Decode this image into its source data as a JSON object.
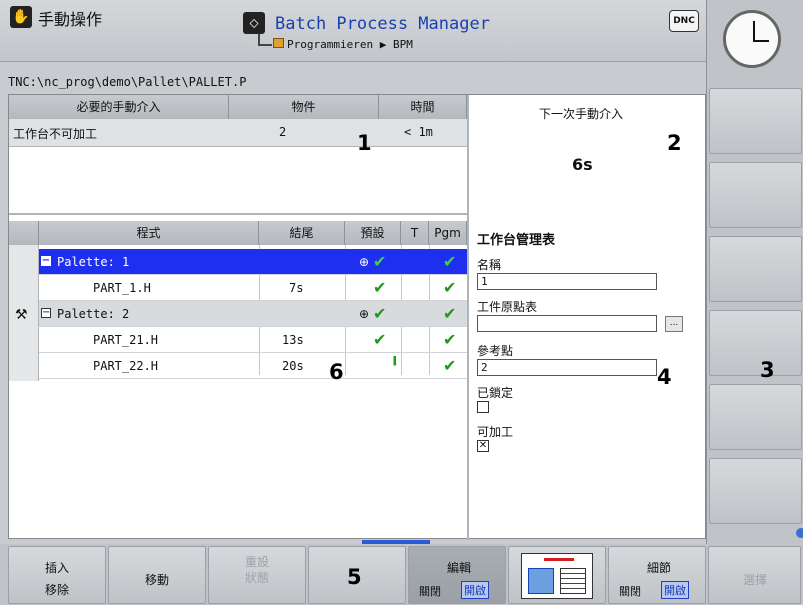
{
  "header": {
    "mode_title": "手動操作",
    "app_title": "Batch Process Manager",
    "breadcrumb": "Programmieren ▶ BPM",
    "dnc_label": "DNC"
  },
  "path": "TNC:\\nc_prog\\demo\\Pallet\\PALLET.P",
  "interventions": {
    "headers": [
      "必要的手動介入",
      "物件",
      "時間"
    ],
    "rows": [
      {
        "desc": "工作台不可加工",
        "object": "2",
        "time": "< 1m"
      }
    ],
    "next_label": "下一次手動介入",
    "next_value": "6s"
  },
  "program_table": {
    "headers": [
      "程式",
      "結尾",
      "預設",
      "T",
      "Pgm"
    ],
    "rows": [
      {
        "name": "Palette: 1",
        "end": "",
        "selected": true
      },
      {
        "name": "PART_1.H",
        "end": "7s"
      },
      {
        "name": "Palette: 2",
        "end": ""
      },
      {
        "name": "PART_21.H",
        "end": "13s"
      },
      {
        "name": "PART_22.H",
        "end": "20s"
      }
    ]
  },
  "pallet_form": {
    "title": "工作台管理表",
    "name_label": "名稱",
    "name_value": "1",
    "datum_label": "工件原點表",
    "datum_value": "",
    "ref_label": "參考點",
    "ref_value": "2",
    "locked_label": "已鎖定",
    "locked_checked": false,
    "machinable_label": "可加工",
    "machinable_checked": true,
    "browse_label": "..."
  },
  "callouts": {
    "n1": "1",
    "n2": "2",
    "n3": "3",
    "n4": "4",
    "n5": "5",
    "n6": "6"
  },
  "softkeys": {
    "insert": "插入",
    "remove": "移除",
    "move": "移動",
    "reset_line1": "重設",
    "reset_line2": "狀態",
    "edit": "編輯",
    "off": "關閉",
    "on": "開啟",
    "detail": "細節",
    "select": "選擇"
  },
  "colors": {
    "selected_row": "#1f2ff0",
    "title_blue": "#1a3fb0",
    "check_green": "#1a9c1a"
  }
}
